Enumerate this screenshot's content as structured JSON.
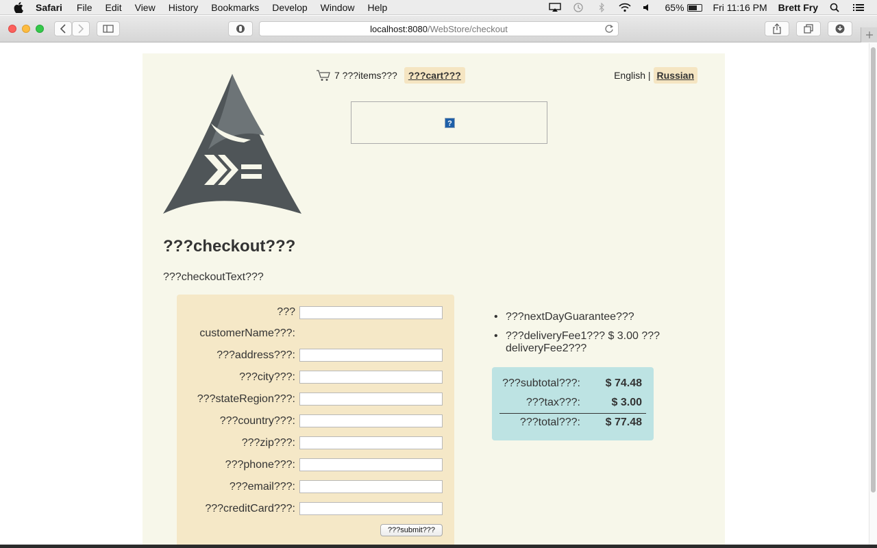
{
  "menubar": {
    "app_name": "Safari",
    "items": [
      "File",
      "Edit",
      "View",
      "History",
      "Bookmarks",
      "Develop",
      "Window",
      "Help"
    ],
    "battery_percent": "65%",
    "battery_level": 0.65,
    "clock": "Fri 11:16 PM",
    "user": "Brett Fry",
    "icons": [
      "apple-icon",
      "airplay-icon",
      "time-machine-icon",
      "bluetooth-icon",
      "wifi-icon",
      "volume-icon",
      "battery-icon",
      "spotlight-icon",
      "notification-center-icon"
    ]
  },
  "browser": {
    "url_host": "localhost:8080",
    "url_path": "/WebStore/checkout",
    "icons": [
      "back-icon",
      "forward-icon",
      "sidebar-icon",
      "privacy-shield-icon",
      "reload-icon",
      "share-icon",
      "tabs-overview-icon",
      "downloads-icon",
      "new-tab-icon"
    ]
  },
  "header": {
    "cart_count": "7 ???items???",
    "cart_link": "???cart???",
    "lang_english": "English |",
    "lang_russian": "Russian"
  },
  "page": {
    "title": "???checkout???",
    "intro": "???checkoutText???"
  },
  "form": {
    "fields": [
      {
        "label_line1": "???",
        "label_line2": "customerName???:"
      },
      {
        "label": "???address???:"
      },
      {
        "label": "???city???:"
      },
      {
        "label": "???stateRegion???:"
      },
      {
        "label": "???country???:"
      },
      {
        "label": "???zip???:"
      },
      {
        "label": "???phone???:"
      },
      {
        "label": "???email???:"
      },
      {
        "label": "???creditCard???:"
      }
    ],
    "submit_label": "???submit???"
  },
  "info": {
    "items": [
      "???nextDayGuarantee???",
      "???deliveryFee1??? $ 3.00 ??? deliveryFee2???"
    ]
  },
  "totals": {
    "subtotal_label": "???subtotal???:",
    "subtotal_value": "$ 74.48",
    "tax_label": "???tax???:",
    "tax_value": "$ 3.00",
    "total_label": "???total???:",
    "total_value": "$ 77.48"
  },
  "colors": {
    "page_bg": "#f7f7ea",
    "form_bg": "#f5e8c7",
    "totals_bg": "#bde3e3",
    "highlight_bg": "#f5e5c2",
    "logo_fill": "#4f5558"
  }
}
